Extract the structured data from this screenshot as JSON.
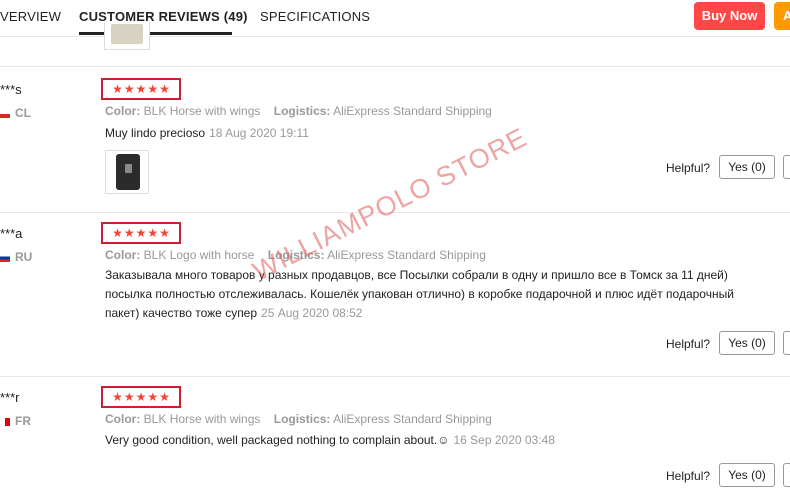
{
  "tabs": {
    "overview": "VERVIEW",
    "reviews": "CUSTOMER REVIEWS (49)",
    "specifications": "SPECIFICATIONS"
  },
  "actions": {
    "buy_now": "Buy Now",
    "add": "A"
  },
  "labels": {
    "color": "Color:",
    "logistics": "Logistics:",
    "helpful": "Helpful?"
  },
  "reviews": [
    {
      "user": "***s",
      "country": "CL",
      "rating": 5,
      "color": "BLK Horse with wings",
      "logistics": "AliExpress Standard Shipping",
      "text": "Muy lindo precioso",
      "date": "18 Aug 2020 19:11",
      "yes": "Yes (0)"
    },
    {
      "user": "***a",
      "country": "RU",
      "rating": 5,
      "color": "BLK Logo with horse",
      "logistics": "AliExpress Standard Shipping",
      "text": "Заказывала много товаров у разных продавцов, все Посылки собрали в одну и пришло все в Томск за 11 дней) посылка полностью отслеживалась. Кошелёк упакован отлично) в коробке подарочной и плюс идёт подарочный пакет) качество тоже супер",
      "date": "25 Aug 2020 08:52",
      "yes": "Yes (0)"
    },
    {
      "user": "***r",
      "country": "FR",
      "rating": 5,
      "color": "BLK Horse with wings",
      "logistics": "AliExpress Standard Shipping",
      "text": "Very good condition, well packaged nothing to complain about.☺",
      "date": "16 Sep 2020 03:48",
      "yes": "Yes (0)"
    }
  ],
  "watermark": "WILLIAMPOLO STORE",
  "colors": {
    "buy_now": "#ff4747",
    "add_to_cart": "#ff9900",
    "star": "#f44336",
    "highlight_box": "#cc1f36"
  }
}
